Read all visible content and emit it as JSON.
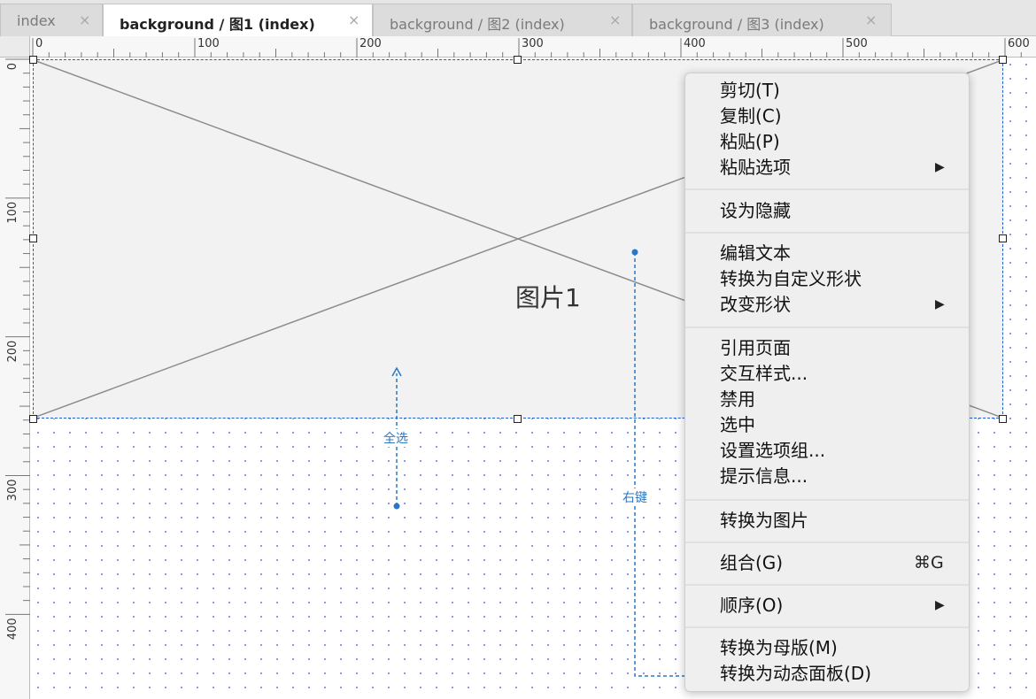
{
  "tabs": [
    {
      "label": "index",
      "active": false
    },
    {
      "label": "background / 图1 (index)",
      "active": true
    },
    {
      "label": "background / 图2 (index)",
      "active": false
    },
    {
      "label": "background / 图3 (index)",
      "active": false
    }
  ],
  "tab_close_glyph": "×",
  "ruler": {
    "h_labels": [
      "0",
      "100",
      "200",
      "300",
      "400",
      "500",
      "600"
    ],
    "v_labels": [
      "0",
      "100",
      "200",
      "300",
      "400"
    ]
  },
  "placeholder": {
    "label": "图片1"
  },
  "annotations": {
    "select_all": "全选",
    "right_click": "右键"
  },
  "context_menu": {
    "groups": [
      [
        {
          "label": "剪切(T)"
        },
        {
          "label": "复制(C)"
        },
        {
          "label": "粘贴(P)"
        },
        {
          "label": "粘贴选项",
          "submenu": true
        }
      ],
      [
        {
          "label": "设为隐藏"
        }
      ],
      [
        {
          "label": "编辑文本"
        },
        {
          "label": "转换为自定义形状"
        },
        {
          "label": "改变形状",
          "submenu": true
        }
      ],
      [
        {
          "label": "引用页面"
        },
        {
          "label": "交互样式..."
        },
        {
          "label": "禁用"
        },
        {
          "label": "选中"
        },
        {
          "label": "设置选项组..."
        },
        {
          "label": "提示信息..."
        }
      ],
      [
        {
          "label": "转换为图片"
        }
      ],
      [
        {
          "label": "组合(G)",
          "shortcut": "⌘G"
        }
      ],
      [
        {
          "label": "顺序(O)",
          "submenu": true
        }
      ],
      [
        {
          "label": "转换为母版(M)"
        },
        {
          "label": "转换为动态面板(D)"
        }
      ]
    ],
    "submenu_glyph": "▶"
  },
  "colors": {
    "selection": "#1e5fc8",
    "annotation": "#2a78c4",
    "grid_dot": "#8f8fe8"
  },
  "icons": {
    "close": "close-icon",
    "submenu": "submenu-arrow-icon"
  }
}
